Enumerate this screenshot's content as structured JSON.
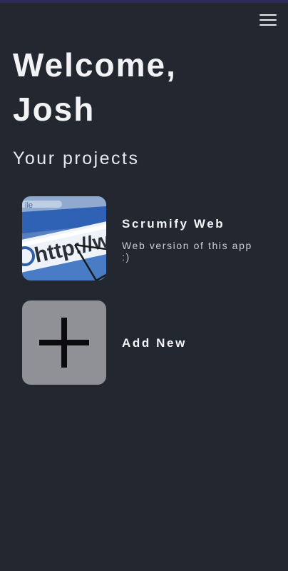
{
  "header": {
    "menu_icon": "hamburger-menu-icon"
  },
  "welcome": {
    "line1": "Welcome,",
    "line2": "Josh"
  },
  "section": {
    "title": "Your projects"
  },
  "projects": [
    {
      "name": "Scrumify Web",
      "description": "Web version of this app :)",
      "thumbnail_icon": "web-browser-url-icon"
    }
  ],
  "add_new": {
    "label": "Add New",
    "icon": "plus-icon"
  },
  "colors": {
    "background": "#232730",
    "text": "#f3f3f5",
    "add_tile": "#909196",
    "top_strip": "#2d2a5c"
  }
}
